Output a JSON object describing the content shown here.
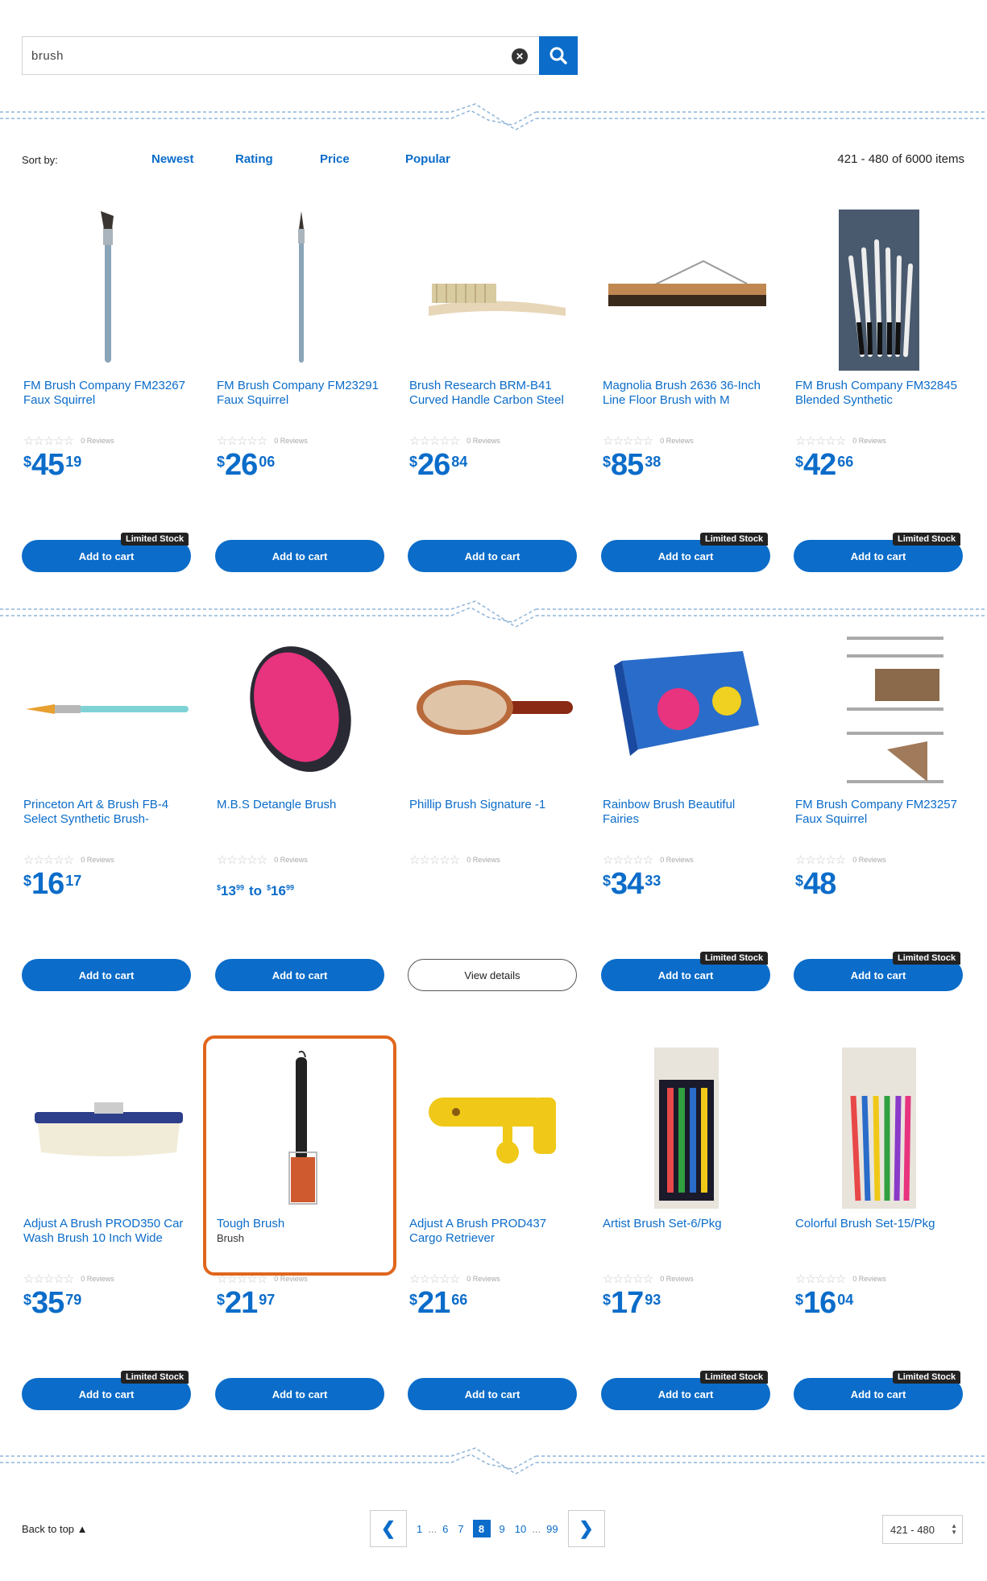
{
  "search": {
    "value": "brush",
    "clear_glyph": "✕",
    "button_icon": "search-icon"
  },
  "sort": {
    "label": "Sort by:",
    "options": [
      "Newest",
      "Rating",
      "Price",
      "Popular"
    ],
    "count": "421 - 480 of 6000 items"
  },
  "common": {
    "stars": "☆☆☆☆☆",
    "reviews": "0 Reviews",
    "add_to_cart": "Add to cart",
    "view_details": "View details",
    "limited_stock": "Limited Stock",
    "currency": "$"
  },
  "products": [
    {
      "title": "FM Brush Company FM23267 Faux Squirrel",
      "dollars": "45",
      "cents": "19",
      "limited": "Limited Stock",
      "image": "flat-paint-brush"
    },
    {
      "title": "FM Brush Company FM23291 Faux Squirrel",
      "dollars": "26",
      "cents": "06",
      "limited": "",
      "image": "round-paint-brush"
    },
    {
      "title": "Brush Research BRM-B41 Curved Handle Carbon Steel",
      "dollars": "26",
      "cents": "84",
      "limited": "",
      "image": "wire-brush"
    },
    {
      "title": "Magnolia Brush 2636 36-Inch Line Floor Brush with M",
      "dollars": "85",
      "cents": "38",
      "limited": "Limited Stock",
      "image": "floor-broom"
    },
    {
      "title": "FM Brush Company FM32845 Blended Synthetic",
      "dollars": "42",
      "cents": "66",
      "limited": "Limited Stock",
      "image": "brush-set-photo"
    },
    {
      "title": "Princeton Art & Brush FB-4 Select Synthetic Brush-",
      "dollars": "16",
      "cents": "17",
      "limited": "",
      "image": "teal-brush"
    },
    {
      "title": "M.B.S Detangle Brush",
      "range": {
        "low_d": "13",
        "low_c": "99",
        "high_d": "16",
        "high_c": "99",
        "to": "to"
      },
      "limited": "",
      "image": "detangle-brush"
    },
    {
      "title": "Phillip Brush Signature -1",
      "view": true,
      "limited": "",
      "image": "paddle-brush"
    },
    {
      "title": "Rainbow Brush Beautiful Fairies",
      "dollars": "34",
      "cents": "33",
      "limited": "Limited Stock",
      "image": "fairies-box"
    },
    {
      "title": "FM Brush Company FM23257 Faux Squirrel",
      "dollars": "48",
      "cents": "",
      "limited": "Limited Stock",
      "image": "brush-assortment"
    },
    {
      "title": "Adjust A Brush PROD350 Car Wash Brush 10 Inch Wide",
      "dollars": "35",
      "cents": "79",
      "limited": "Limited Stock",
      "image": "car-wash-brush"
    },
    {
      "title": "Tough Brush",
      "subtitle": "Brush",
      "dollars": "21",
      "cents": "97",
      "limited": "",
      "image": "tough-brush"
    },
    {
      "title": "Adjust A Brush PROD437 Cargo Retriever",
      "dollars": "21",
      "cents": "66",
      "limited": "",
      "image": "cargo-retriever"
    },
    {
      "title": "Artist Brush Set-6/Pkg",
      "dollars": "17",
      "cents": "93",
      "limited": "Limited Stock",
      "image": "artist-brush-set"
    },
    {
      "title": "Colorful Brush Set-15/Pkg",
      "dollars": "16",
      "cents": "04",
      "limited": "Limited Stock",
      "image": "colorful-brush-set"
    }
  ],
  "footer": {
    "back_to_top": "Back to top ▲",
    "pages": [
      "1",
      "6",
      "7",
      "8",
      "9",
      "10",
      "99"
    ],
    "current_page": "8",
    "ellipsis": "...",
    "prev": "❮",
    "next": "❯",
    "range_select": "421 - 480"
  },
  "colors": {
    "accent": "#0b6cc9",
    "highlight": "#e0661d",
    "badge": "#222222"
  }
}
